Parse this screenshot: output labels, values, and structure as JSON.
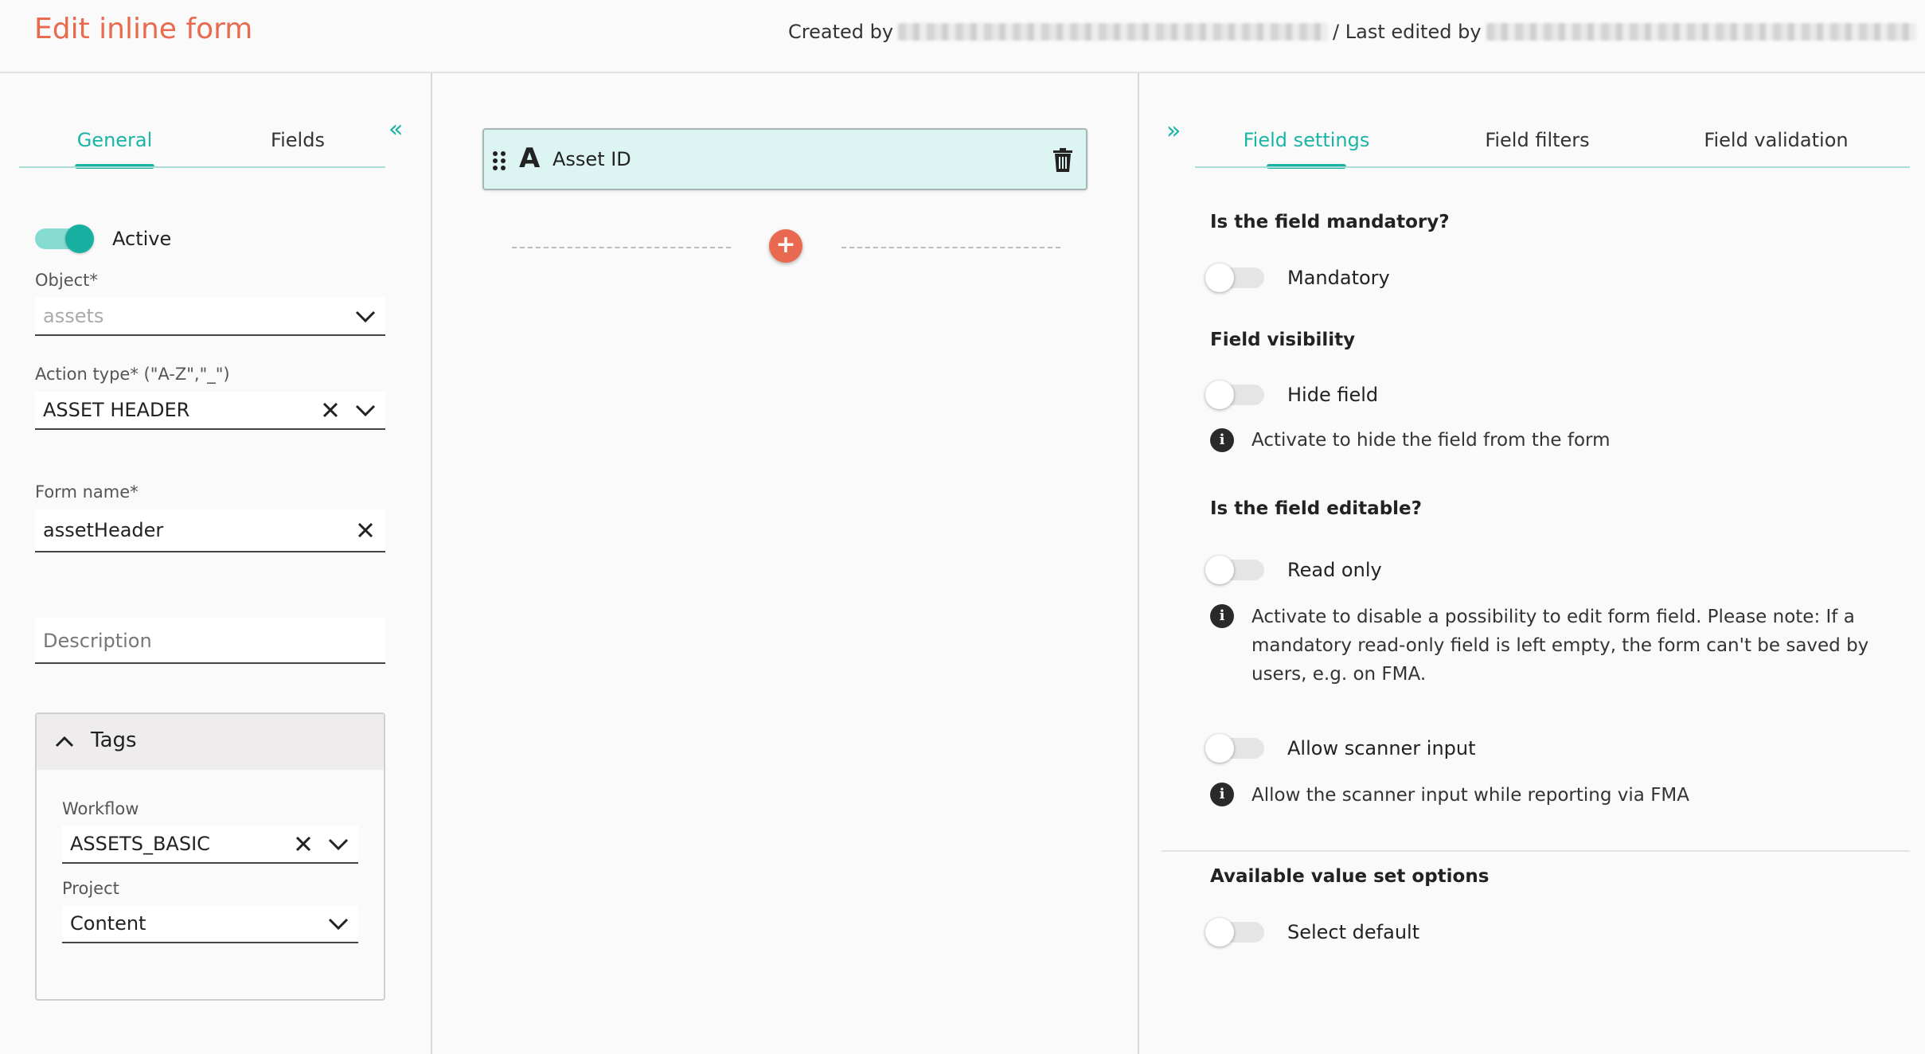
{
  "header": {
    "title": "Edit inline form",
    "created_by_label": "Created by",
    "last_edited_label": "/ Last edited by"
  },
  "left": {
    "tabs": [
      {
        "label": "General",
        "active": true
      },
      {
        "label": "Fields",
        "active": false
      }
    ],
    "active_toggle": {
      "label": "Active",
      "on": true
    },
    "object": {
      "label": "Object*",
      "placeholder": "assets"
    },
    "action_type": {
      "label": "Action type* (\"A-Z\",\"_\")",
      "value": "ASSET HEADER"
    },
    "form_name": {
      "label": "Form name*",
      "value": "assetHeader"
    },
    "description": {
      "placeholder": "Description"
    },
    "tags": {
      "title": "Tags",
      "workflow": {
        "label": "Workflow",
        "value": "ASSETS_BASIC"
      },
      "project": {
        "label": "Project",
        "value": "Content"
      }
    }
  },
  "middle": {
    "field_card": {
      "type_glyph": "A",
      "name": "Asset ID"
    },
    "add_symbol": "+"
  },
  "right": {
    "tabs": [
      {
        "label": "Field settings",
        "active": true
      },
      {
        "label": "Field filters",
        "active": false
      },
      {
        "label": "Field validation",
        "active": false
      }
    ],
    "mandatory": {
      "title": "Is the field mandatory?",
      "toggle_label": "Mandatory",
      "on": false
    },
    "visibility": {
      "title": "Field visibility",
      "toggle_label": "Hide field",
      "on": false,
      "info": "Activate to hide the field from the form"
    },
    "editable": {
      "title": "Is the field editable?",
      "toggle_label": "Read only",
      "on": false,
      "info": "Activate to disable a possibility to edit form field. Please note: If a mandatory read-only field is left empty, the form can't be saved by users, e.g. on FMA."
    },
    "scanner": {
      "toggle_label": "Allow scanner input",
      "on": false,
      "info": "Allow the scanner input while reporting via FMA"
    },
    "value_set": {
      "title": "Available value set options",
      "toggle_label": "Select default",
      "on": false
    }
  },
  "colors": {
    "accent_orange": "#e86a4f",
    "accent_teal": "#19b2a3",
    "card_bg": "#dcf4f2"
  }
}
